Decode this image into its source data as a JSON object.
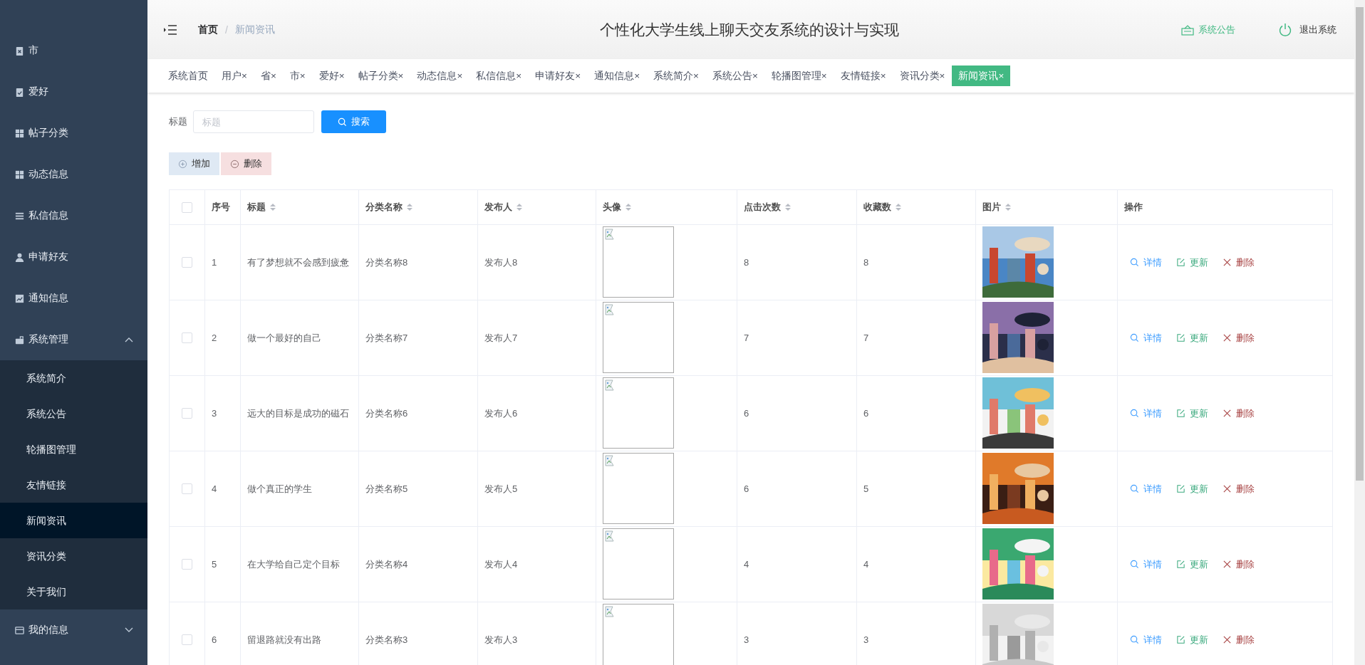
{
  "sidebar": {
    "items": [
      {
        "label": "市"
      },
      {
        "label": "爱好"
      },
      {
        "label": "帖子分类"
      },
      {
        "label": "动态信息"
      },
      {
        "label": "私信信息"
      },
      {
        "label": "申请好友"
      },
      {
        "label": "通知信息"
      },
      {
        "label": "系统管理",
        "expanded": true,
        "children": [
          {
            "label": "系统简介",
            "selected": false
          },
          {
            "label": "系统公告",
            "selected": false
          },
          {
            "label": "轮播图管理",
            "selected": false
          },
          {
            "label": "友情链接",
            "selected": false
          },
          {
            "label": "新闻资讯",
            "selected": true
          },
          {
            "label": "资讯分类",
            "selected": false
          },
          {
            "label": "关于我们",
            "selected": false
          }
        ]
      },
      {
        "label": "我的信息",
        "expanded": false
      }
    ]
  },
  "header": {
    "breadcrumb": [
      "首页",
      "新闻资讯"
    ],
    "separator": "/",
    "title": "个性化大学生线上聊天交友系统的设计与实现",
    "notice": "系统公告",
    "logout": "退出系统"
  },
  "tabs": [
    {
      "label": "系统首页",
      "selected": false
    },
    {
      "label": "用户",
      "close": "×",
      "selected": false
    },
    {
      "label": "省",
      "close": "×",
      "selected": false
    },
    {
      "label": "市",
      "close": "×",
      "selected": false
    },
    {
      "label": "爱好",
      "close": "×",
      "selected": false
    },
    {
      "label": "帖子分类",
      "close": "×",
      "selected": false
    },
    {
      "label": "动态信息",
      "close": "×",
      "selected": false
    },
    {
      "label": "私信信息",
      "close": "×",
      "selected": false
    },
    {
      "label": "申请好友",
      "close": "×",
      "selected": false
    },
    {
      "label": "通知信息",
      "close": "×",
      "selected": false
    },
    {
      "label": "系统简介",
      "close": "×",
      "selected": false
    },
    {
      "label": "系统公告",
      "close": "×",
      "selected": false
    },
    {
      "label": "轮播图管理",
      "close": "×",
      "selected": false
    },
    {
      "label": "友情链接",
      "close": "×",
      "selected": false
    },
    {
      "label": "资讯分类",
      "close": "×",
      "selected": false
    },
    {
      "label": "新闻资讯",
      "close": "×",
      "selected": true
    }
  ],
  "search": {
    "label": "标题",
    "placeholder": "标题",
    "button": "搜索"
  },
  "actions": {
    "add": "增加",
    "delete": "删除"
  },
  "table": {
    "all_checked": false,
    "columns": [
      "序号",
      "标题",
      "分类名称",
      "发布人",
      "头像",
      "点击次数",
      "收藏数",
      "图片",
      "操作"
    ],
    "rows": [
      {
        "checked": false,
        "index": "1",
        "title": "有了梦想就不会感到疲惫",
        "category": "分类名称8",
        "publisher": "发布人8",
        "clicks": "8",
        "favorites": "8",
        "ops": [
          "详情",
          "更新",
          "删除"
        ]
      },
      {
        "checked": false,
        "index": "2",
        "title": "做一个最好的自己",
        "category": "分类名称7",
        "publisher": "发布人7",
        "clicks": "7",
        "favorites": "7",
        "ops": [
          "详情",
          "更新",
          "删除"
        ]
      },
      {
        "checked": false,
        "index": "3",
        "title": "远大的目标是成功的磁石",
        "category": "分类名称6",
        "publisher": "发布人6",
        "clicks": "6",
        "favorites": "6",
        "ops": [
          "详情",
          "更新",
          "删除"
        ]
      },
      {
        "checked": false,
        "index": "4",
        "title": "做个真正的学生",
        "category": "分类名称5",
        "publisher": "发布人5",
        "clicks": "6",
        "favorites": "5",
        "ops": [
          "详情",
          "更新",
          "删除"
        ]
      },
      {
        "checked": false,
        "index": "5",
        "title": "在大学给自己定个目标",
        "category": "分类名称4",
        "publisher": "发布人4",
        "clicks": "4",
        "favorites": "4",
        "ops": [
          "详情",
          "更新",
          "删除"
        ]
      },
      {
        "checked": false,
        "index": "6",
        "title": "留退路就没有出路",
        "category": "分类名称3",
        "publisher": "发布人3",
        "clicks": "3",
        "favorites": "3",
        "ops": [
          "详情",
          "更新",
          "删除"
        ]
      }
    ]
  }
}
